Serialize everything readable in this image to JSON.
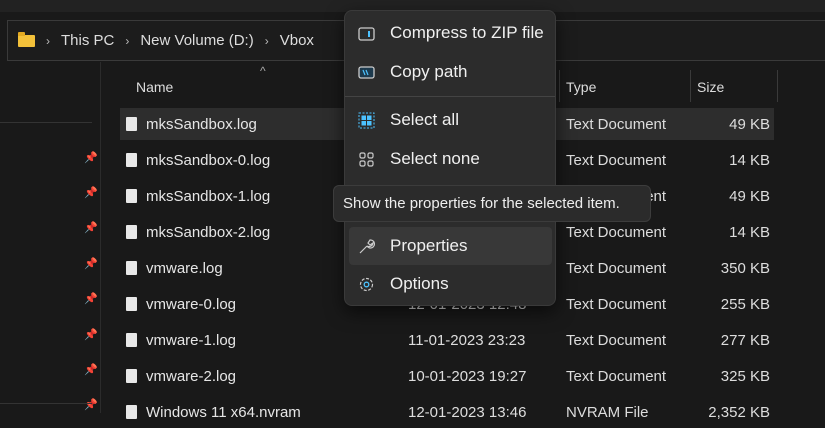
{
  "breadcrumb": [
    "This PC",
    "New Volume (D:)",
    "Vbox"
  ],
  "columns": {
    "name": "Name",
    "type": "Type",
    "size": "Size"
  },
  "files": [
    {
      "name": "mksSandbox.log",
      "date": "",
      "type": "Text Document",
      "size": "49 KB"
    },
    {
      "name": "mksSandbox-0.log",
      "date": "",
      "type": "Text Document",
      "size": "14 KB"
    },
    {
      "name": "mksSandbox-1.log",
      "date": "",
      "type": "Text Document",
      "size": "49 KB"
    },
    {
      "name": "mksSandbox-2.log",
      "date": "",
      "type": "Text Document",
      "size": "14 KB"
    },
    {
      "name": "vmware.log",
      "date": "",
      "type": "Text Document",
      "size": "350 KB"
    },
    {
      "name": "vmware-0.log",
      "date": "12-01-2023 12:48",
      "type": "Text Document",
      "size": "255 KB"
    },
    {
      "name": "vmware-1.log",
      "date": "11-01-2023 23:23",
      "type": "Text Document",
      "size": "277 KB"
    },
    {
      "name": "vmware-2.log",
      "date": "10-01-2023 19:27",
      "type": "Text Document",
      "size": "325 KB"
    },
    {
      "name": "Windows 11 x64.nvram",
      "date": "12-01-2023 13:46",
      "type": "NVRAM File",
      "size": "2,352 KB"
    }
  ],
  "menu": {
    "compress": "Compress to ZIP file",
    "copy_path": "Copy path",
    "select_all": "Select all",
    "select_none": "Select none",
    "properties": "Properties",
    "options": "Options"
  },
  "tooltip": "Show the properties for the selected item.",
  "colors": {
    "accent": "#4cc2ff",
    "folder": "#f3c13a"
  }
}
